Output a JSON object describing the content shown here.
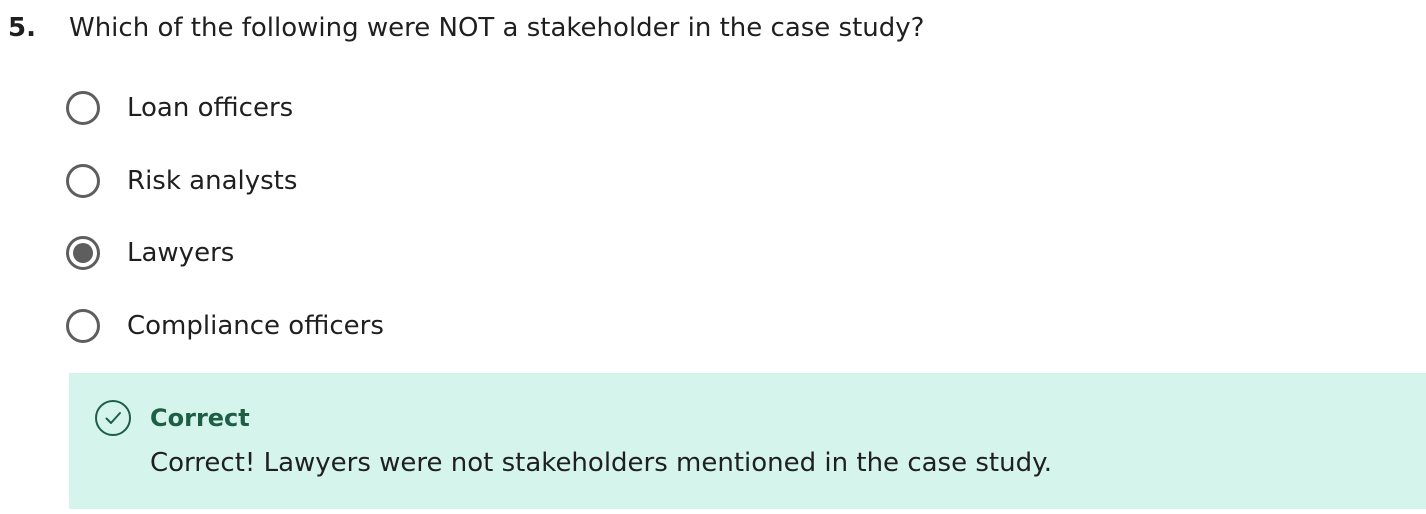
{
  "question": {
    "number": "5.",
    "text": "Which of the following were NOT a stakeholder in the case study?",
    "options": [
      {
        "label": "Loan officers",
        "selected": false
      },
      {
        "label": "Risk analysts",
        "selected": false
      },
      {
        "label": "Lawyers",
        "selected": true
      },
      {
        "label": "Compliance officers",
        "selected": false
      }
    ]
  },
  "feedback": {
    "icon": "check-circle-icon",
    "title": "Correct",
    "message": "Correct! Lawyers were not stakeholders mentioned in the case study.",
    "background_color": "#d5f5ec",
    "accent_color": "#1e5e45"
  }
}
